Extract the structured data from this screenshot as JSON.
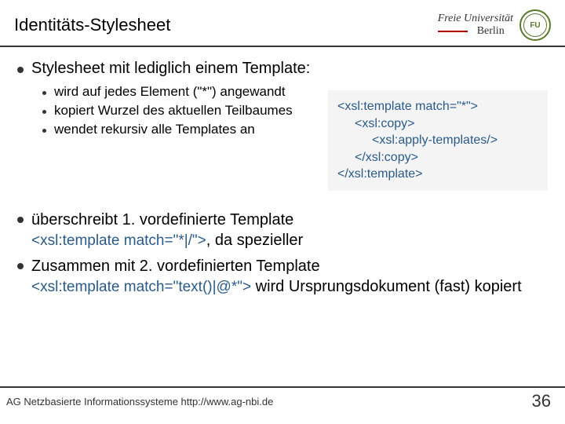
{
  "header": {
    "title": "Identitäts-Stylesheet",
    "university": {
      "line1": "Freie Universität",
      "line2": "Berlin",
      "seal_abbr": "FU"
    }
  },
  "main": {
    "intro": "Stylesheet mit lediglich einem Template:",
    "sub_bullets": [
      "wird auf jedes Element (\"*\") angewandt",
      "kopiert Wurzel des aktuellen Teilbaumes",
      "wendet rekursiv alle Templates an"
    ],
    "code": {
      "l1": "<xsl:template match=\"*\">",
      "l2": "<xsl:copy>",
      "l3": "<xsl:apply-templates/>",
      "l4": "</xsl:copy>",
      "l5": "</xsl:template>"
    },
    "lower": [
      {
        "line1": "überschreibt 1. vordefinierte Template",
        "tag": "<xsl:template match=\"*|/\">",
        "tail": ", da spezieller"
      },
      {
        "line1": "Zusammen mit 2. vordefinierten Template",
        "tag": "<xsl:template match=\"text()|@*\">",
        "tail": " wird Ursprungsdokument (fast) kopiert"
      }
    ]
  },
  "footer": {
    "text": "AG Netzbasierte Informationssysteme http://www.ag-nbi.de",
    "page": "36"
  }
}
